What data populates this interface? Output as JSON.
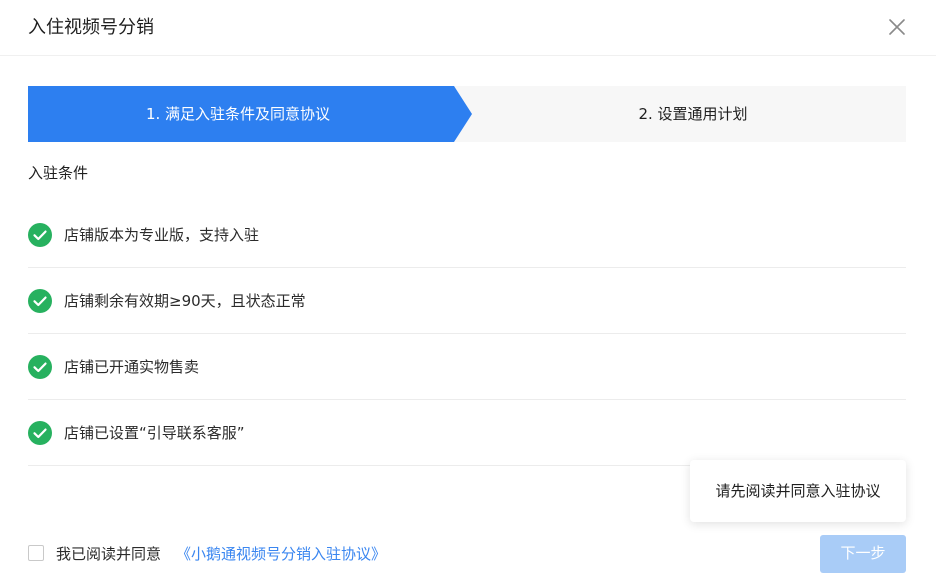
{
  "dialog": {
    "title": "入住视频号分销",
    "close_icon": "close-icon"
  },
  "steps": [
    {
      "label": "1. 满足入驻条件及同意协议",
      "active": true
    },
    {
      "label": "2. 设置通用计划",
      "active": false
    }
  ],
  "conditions": {
    "title": "入驻条件",
    "items": [
      {
        "text": "店铺版本为专业版，支持入驻",
        "icon": "check-circle-icon"
      },
      {
        "text": "店铺剩余有效期≥90天，且状态正常",
        "icon": "check-circle-icon"
      },
      {
        "text": "店铺已开通实物售卖",
        "icon": "check-circle-icon"
      },
      {
        "text": "店铺已设置“引导联系客服”",
        "icon": "check-circle-icon"
      }
    ]
  },
  "tooltip": {
    "text": "请先阅读并同意入驻协议"
  },
  "agreement": {
    "label": "我已阅读并同意",
    "link": "《小鹅通视频号分销入驻协议》",
    "checked": false
  },
  "footer": {
    "next_label": "下一步"
  },
  "colors": {
    "primary": "#2d7ff0",
    "success": "#27b15f",
    "link": "#3a86f0",
    "disabled_button": "#a9ccf7"
  }
}
